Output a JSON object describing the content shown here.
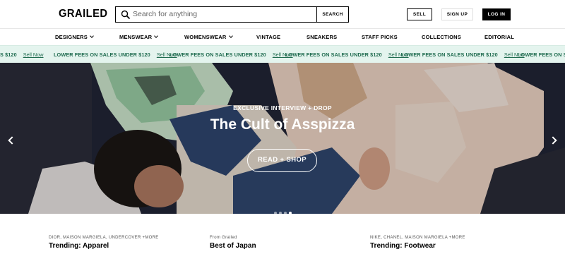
{
  "header": {
    "logo": "GRAILED",
    "search_placeholder": "Search for anything",
    "search_button": "SEARCH",
    "sell": "SELL",
    "sign_up": "SIGN UP",
    "log_in": "LOG IN"
  },
  "nav": [
    {
      "label": "DESIGNERS",
      "dropdown": true
    },
    {
      "label": "MENSWEAR",
      "dropdown": true
    },
    {
      "label": "WOMENSWEAR",
      "dropdown": true
    },
    {
      "label": "VINTAGE",
      "dropdown": false
    },
    {
      "label": "SNEAKERS",
      "dropdown": false
    },
    {
      "label": "STAFF PICKS",
      "dropdown": false
    },
    {
      "label": "COLLECTIONS",
      "dropdown": false
    },
    {
      "label": "EDITORIAL",
      "dropdown": false
    }
  ],
  "promo": {
    "message": "LOWER FEES ON SALES UNDER $120",
    "link": "Sell Now",
    "partial_prefix": "S $120",
    "partial_suffix": "LOWER FEES ON SALES UNDE"
  },
  "hero": {
    "eyebrow": "EXCLUSIVE INTERVIEW + DROP",
    "title": "The Cult of Asspizza",
    "cta": "READ + SHOP",
    "slide_count": 4,
    "active_slide": 4
  },
  "trending": [
    {
      "sub": "DIOR, MAISON MARGIELA, UNDERCOVER +MORE",
      "title": "Trending: Apparel"
    },
    {
      "sub": "From Grailed",
      "title": "Best of Japan"
    },
    {
      "sub": "NIKE, CHANEL, MAISON MARGIELA +MORE",
      "title": "Trending: Footwear"
    }
  ],
  "colors": {
    "promo_bg": "#e4f4ee",
    "promo_text": "#1f6b4f",
    "login_bg": "#000000"
  }
}
